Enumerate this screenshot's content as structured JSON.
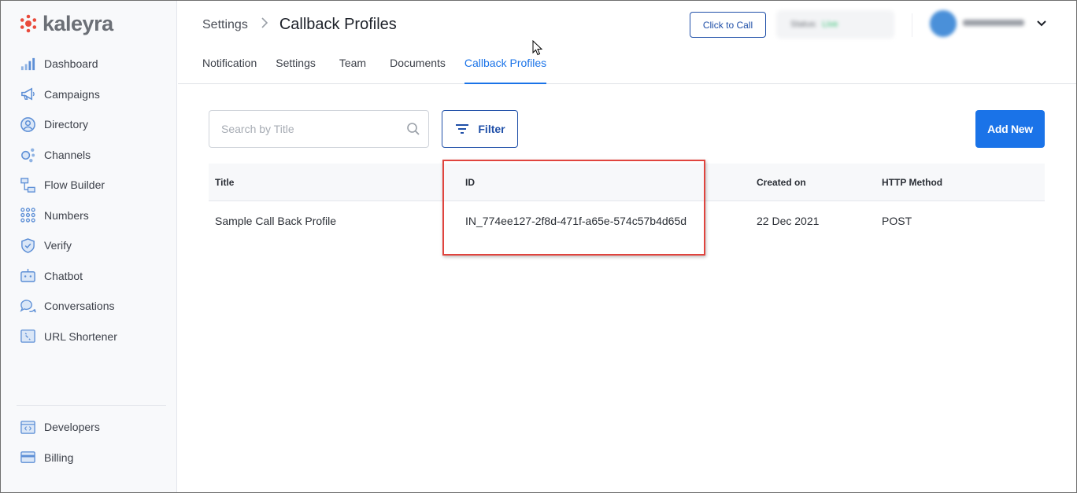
{
  "brand": {
    "name": "kaleyra",
    "logo_color": "#e94b3c"
  },
  "sidebar": {
    "items": [
      {
        "label": "Dashboard",
        "icon": "bar-chart-icon"
      },
      {
        "label": "Campaigns",
        "icon": "megaphone-icon"
      },
      {
        "label": "Directory",
        "icon": "person-circle-icon"
      },
      {
        "label": "Channels",
        "icon": "channels-icon"
      },
      {
        "label": "Flow Builder",
        "icon": "flow-icon"
      },
      {
        "label": "Numbers",
        "icon": "dialpad-icon"
      },
      {
        "label": "Verify",
        "icon": "shield-check-icon"
      },
      {
        "label": "Chatbot",
        "icon": "robot-icon"
      },
      {
        "label": "Conversations",
        "icon": "chat-bubbles-icon"
      },
      {
        "label": "URL Shortener",
        "icon": "link-icon"
      }
    ],
    "bottom_items": [
      {
        "label": "Developers",
        "icon": "code-icon"
      },
      {
        "label": "Billing",
        "icon": "card-icon"
      }
    ]
  },
  "header": {
    "breadcrumb_parent": "Settings",
    "breadcrumb_current": "Callback Profiles",
    "click_to_call_label": "Click to Call",
    "status_label": "Status:",
    "status_value": "Live",
    "tabs": [
      {
        "label": "Notification",
        "active": false
      },
      {
        "label": "Settings",
        "active": false
      },
      {
        "label": "Team",
        "active": false
      },
      {
        "label": "Documents",
        "active": false
      },
      {
        "label": "Callback Profiles",
        "active": true
      }
    ]
  },
  "toolbar": {
    "search_placeholder": "Search by Title",
    "filter_label": "Filter",
    "add_new_label": "Add New"
  },
  "table": {
    "columns": [
      "Title",
      "ID",
      "Created on",
      "HTTP Method"
    ],
    "rows": [
      [
        "Sample Call Back Profile",
        "IN_774ee127-2f8d-471f-a65e-574c57b4d65d",
        "22 Dec 2021",
        "POST"
      ]
    ]
  },
  "colors": {
    "accent": "#1a73e8",
    "highlight_box": "#e0443e"
  }
}
